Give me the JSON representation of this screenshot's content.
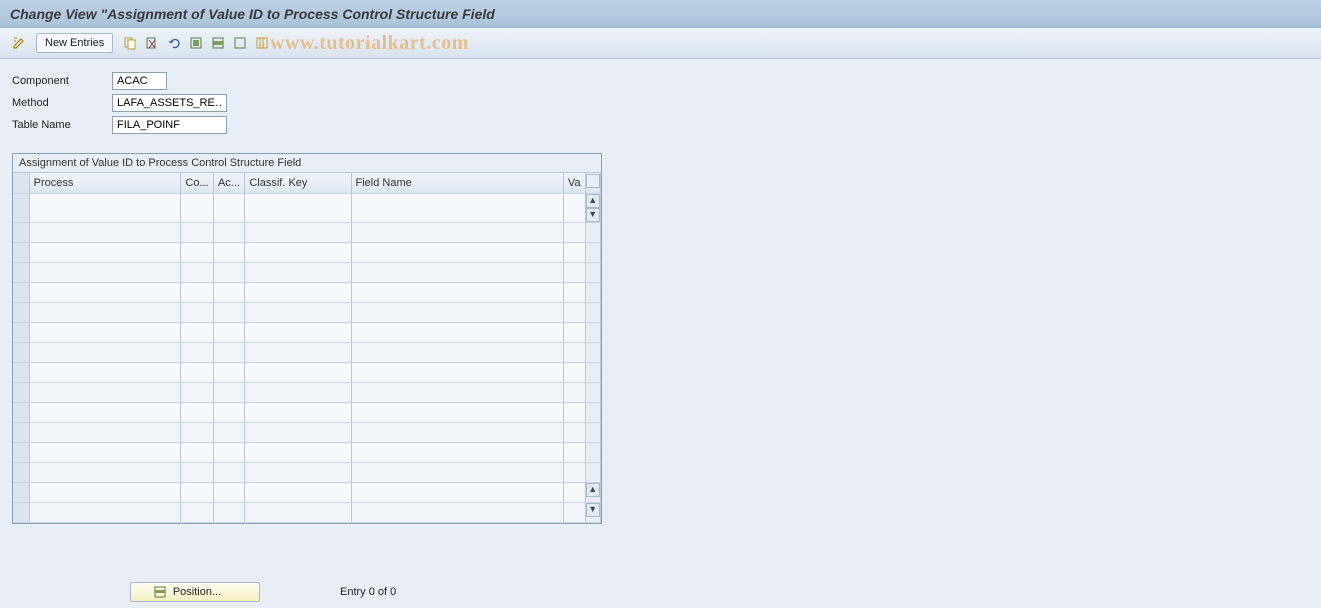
{
  "title": "Change View \"Assignment of Value ID to Process Control Structure Field",
  "toolbar": {
    "new_entries_label": "New Entries"
  },
  "watermark": "www.tutorialkart.com",
  "form": {
    "component_label": "Component",
    "component_value": "ACAC",
    "method_label": "Method",
    "method_value": "LAFA_ASSETS_RE…",
    "table_label": "Table Name",
    "table_value": "FILA_POINF"
  },
  "table": {
    "title": "Assignment of Value ID to Process Control Structure Field",
    "columns": {
      "process": "Process",
      "co": "Co...",
      "ac": "Ac...",
      "classif": "Classif. Key",
      "field": "Field Name",
      "va": "Va"
    },
    "row_count": 16
  },
  "footer": {
    "position_label": "Position...",
    "entry_text": "Entry 0 of 0"
  }
}
